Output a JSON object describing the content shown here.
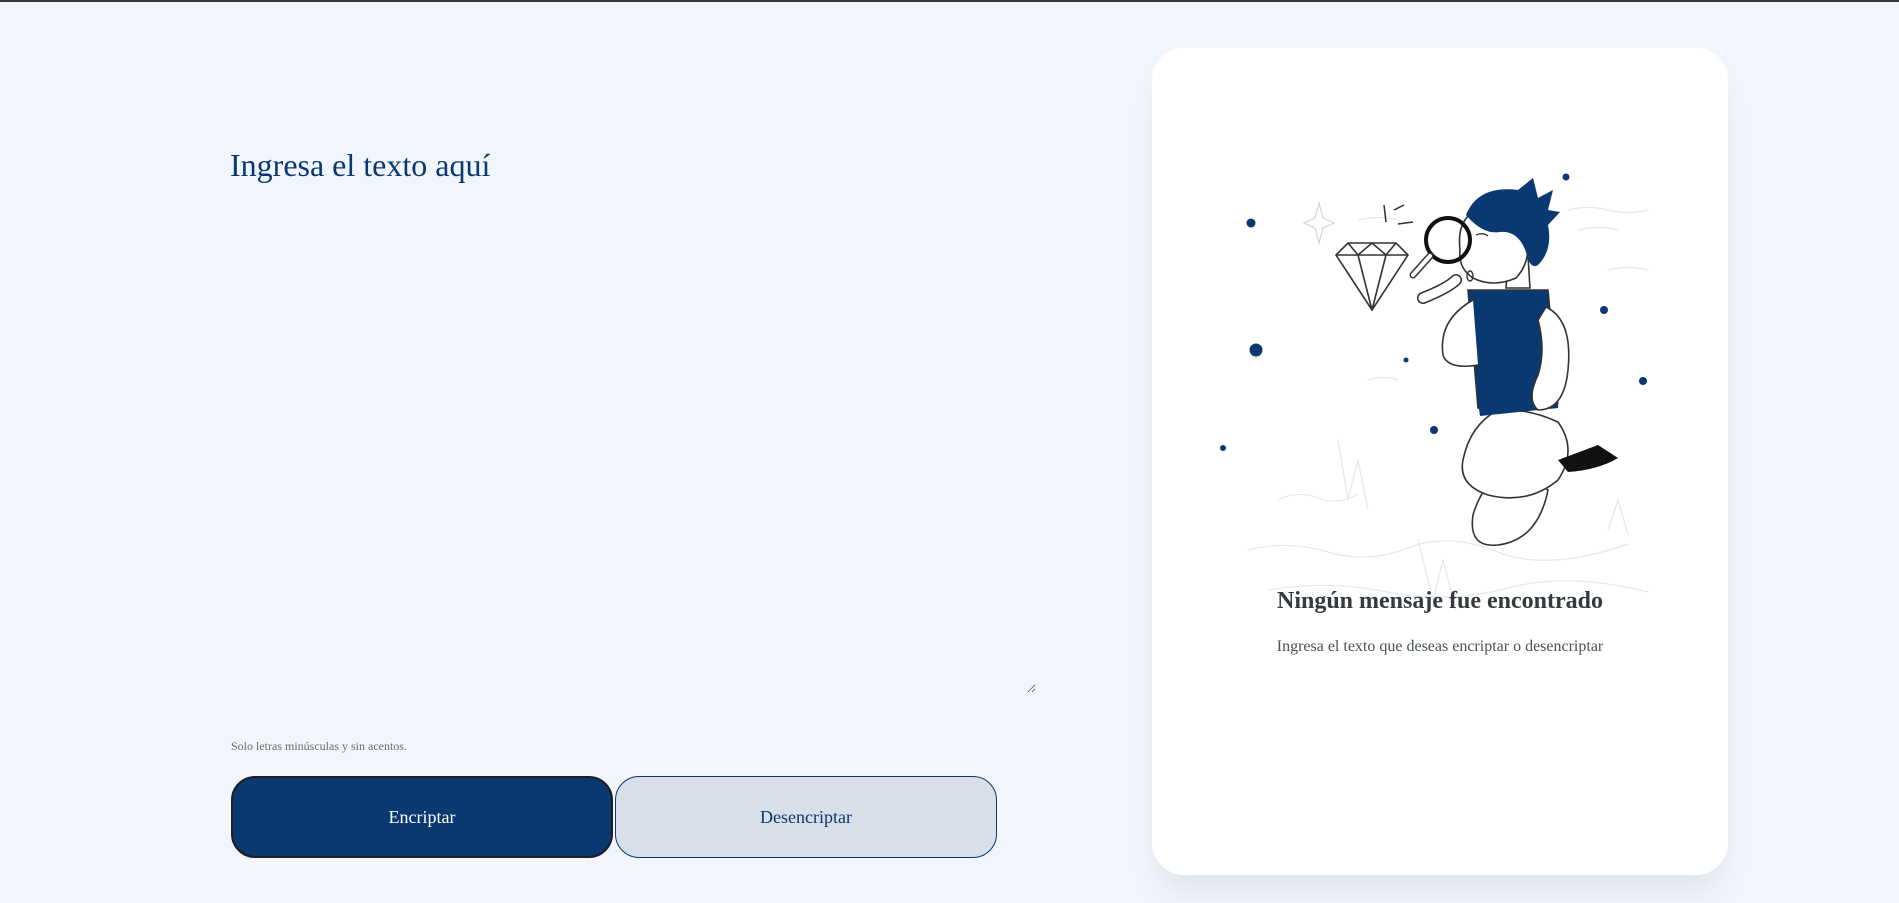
{
  "input": {
    "placeholder": "Ingresa el texto aquí",
    "value": ""
  },
  "hint": {
    "icon": "info-icon",
    "text": "Solo letras minúsculas y sin acentos."
  },
  "buttons": {
    "encrypt_label": "Encriptar",
    "decrypt_label": "Desencriptar"
  },
  "output": {
    "illustration": "person-with-magnifying-glass-illustration",
    "empty_title": "Ningún mensaje fue encontrado",
    "empty_subtitle": "Ingresa el texto que deseas encriptar o desencriptar"
  },
  "colors": {
    "background": "#f1f5fc",
    "primary": "#0a3871",
    "secondary_button": "#d8dfe8",
    "card": "#ffffff",
    "heading_text": "#343a40"
  }
}
